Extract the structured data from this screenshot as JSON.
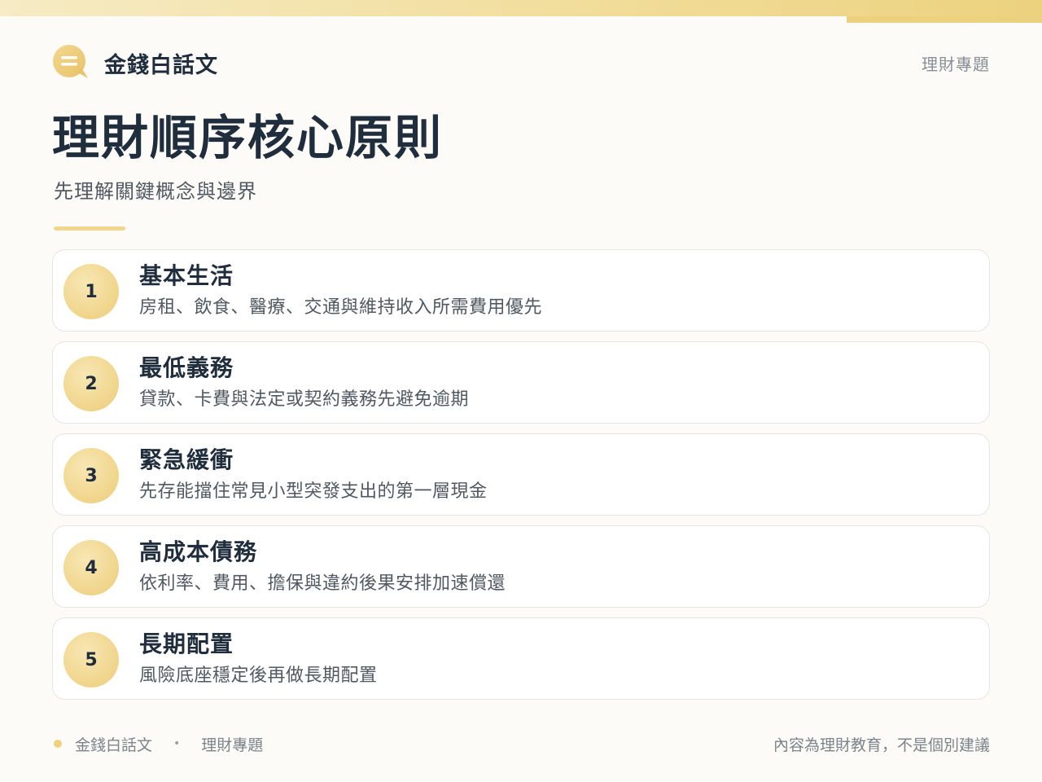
{
  "header": {
    "brand_name": "金錢白話文",
    "topic": "理財專題",
    "icon": "speech-bubble-icon"
  },
  "page": {
    "title": "理財順序核心原則",
    "subtitle": "先理解關鍵概念與邊界"
  },
  "steps": [
    {
      "number": "1",
      "title": "基本生活",
      "description": "房租、飲食、醫療、交通與維持收入所需費用優先"
    },
    {
      "number": "2",
      "title": "最低義務",
      "description": "貸款、卡費與法定或契約義務先避免逾期"
    },
    {
      "number": "3",
      "title": "緊急緩衝",
      "description": "先存能擋住常見小型突發支出的第一層現金"
    },
    {
      "number": "4",
      "title": "高成本債務",
      "description": "依利率、費用、擔保與違約後果安排加速償還"
    },
    {
      "number": "5",
      "title": "長期配置",
      "description": "風險底座穩定後再做長期配置"
    }
  ],
  "footer": {
    "brand_name": "金錢白話文",
    "separator": "•",
    "topic": "理財專題",
    "disclaimer": "內容為理財教育，不是個別建議"
  },
  "colors": {
    "accent": "#f0d48a",
    "text_dark": "#1f2d3d",
    "text_muted": "#505861",
    "background": "#fcfbf8"
  }
}
